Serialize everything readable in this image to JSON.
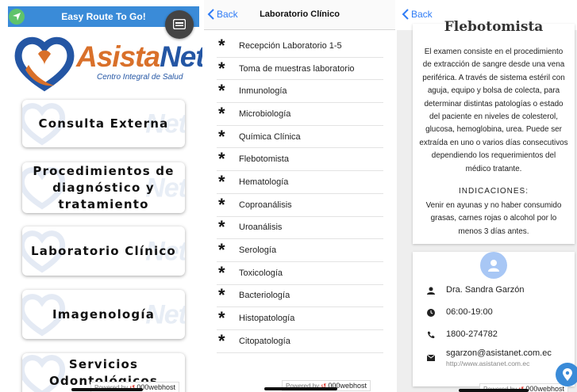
{
  "home": {
    "app_title": "Easy Route To Go!",
    "logo": {
      "brand_part1": "Asista",
      "brand_part2": "Net",
      "tagline": "Centro Integral de Salud"
    },
    "watermark": "Net",
    "menu": [
      {
        "label": "Consulta Externa"
      },
      {
        "label": "Procedimientos de diagnóstico y tratamiento"
      },
      {
        "label": "Laboratorio Clínico"
      },
      {
        "label": "Imagenología"
      },
      {
        "label": "Servicios Odontológicos"
      }
    ],
    "powered_by": "Powered by",
    "host": "000webhost"
  },
  "lab": {
    "back_label": "Back",
    "title": "Laboratorio Clínico",
    "items": [
      "Recepción Laboratorio 1-5",
      "Toma de muestras laboratorio",
      "Inmunología",
      "Microbiología",
      "Química Clínica",
      "Flebotomista",
      "Hematología",
      "Coproanálisis",
      "Uroanálisis",
      "Serología",
      "Toxicología",
      "Bacteriología",
      "Histopatología",
      "Citopatología"
    ],
    "powered_by": "Powered by",
    "host": "000webhost"
  },
  "detail": {
    "back_label": "Back",
    "heading": "Flebotomista",
    "description": "El examen consiste en el procedimiento de extracción de sangre desde una vena periférica. A través de sistema estéril con aguja, equipo y bolsa de colecta, para determinar distintas patologías o estado del paciente en niveles de colesterol, glucosa, hemoglobina, urea. Puede ser extraída en uno o varios días consecutivos dependiendo los requerimientos del médico tratante.",
    "indications_title": "INDICACIONES:",
    "indications_text": "Venir en ayunas y no haber consumido grasas, carnes rojas o alcohol por lo menos 3 días antes.",
    "contact": {
      "doctor": "Dra. Sandra Garzón",
      "hours": "06:00-19:00",
      "phone": "1800-274782",
      "email": "sgarzon@asistanet.com.ec",
      "website": "http://www.asistanet.com.ec"
    },
    "powered_by": "Powered by",
    "host": "000webhost"
  },
  "colors": {
    "accent": "#3a8bd8",
    "brand_orange": "#d9702a",
    "brand_blue": "#2456a4",
    "ios_blue": "#2f7cf6"
  }
}
